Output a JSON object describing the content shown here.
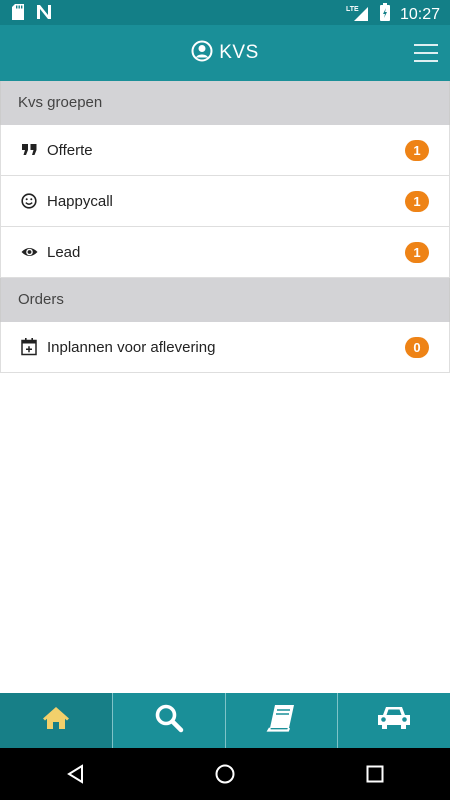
{
  "status_bar": {
    "time": "10:27",
    "network_label": "LTE",
    "icons": [
      "sd-card-icon",
      "n-notification-icon",
      "lte-signal-icon",
      "battery-charging-icon"
    ]
  },
  "app_bar": {
    "title": "KVS",
    "icons": [
      "user-circle-icon",
      "hamburger-menu-icon"
    ]
  },
  "sections": [
    {
      "header": "Kvs groepen",
      "items": [
        {
          "label": "Offerte",
          "count": "1",
          "icon": "quote-icon"
        },
        {
          "label": "Happycall",
          "count": "1",
          "icon": "smiley-icon"
        },
        {
          "label": "Lead",
          "count": "1",
          "icon": "eye-icon"
        }
      ]
    },
    {
      "header": "Orders",
      "items": [
        {
          "label": "Inplannen voor aflevering",
          "count": "0",
          "icon": "calendar-plus-icon"
        }
      ]
    }
  ],
  "bottom_nav": {
    "items": [
      {
        "icon": "home-icon",
        "active": true
      },
      {
        "icon": "search-icon",
        "active": false
      },
      {
        "icon": "book-icon",
        "active": false
      },
      {
        "icon": "car-icon",
        "active": false
      }
    ]
  },
  "colors": {
    "status_bar": "#137f87",
    "app_bar": "#1a8f98",
    "badge": "#ee8316",
    "section_header_bg": "#d3d3d6",
    "active_nav_icon": "#f2d06b"
  }
}
